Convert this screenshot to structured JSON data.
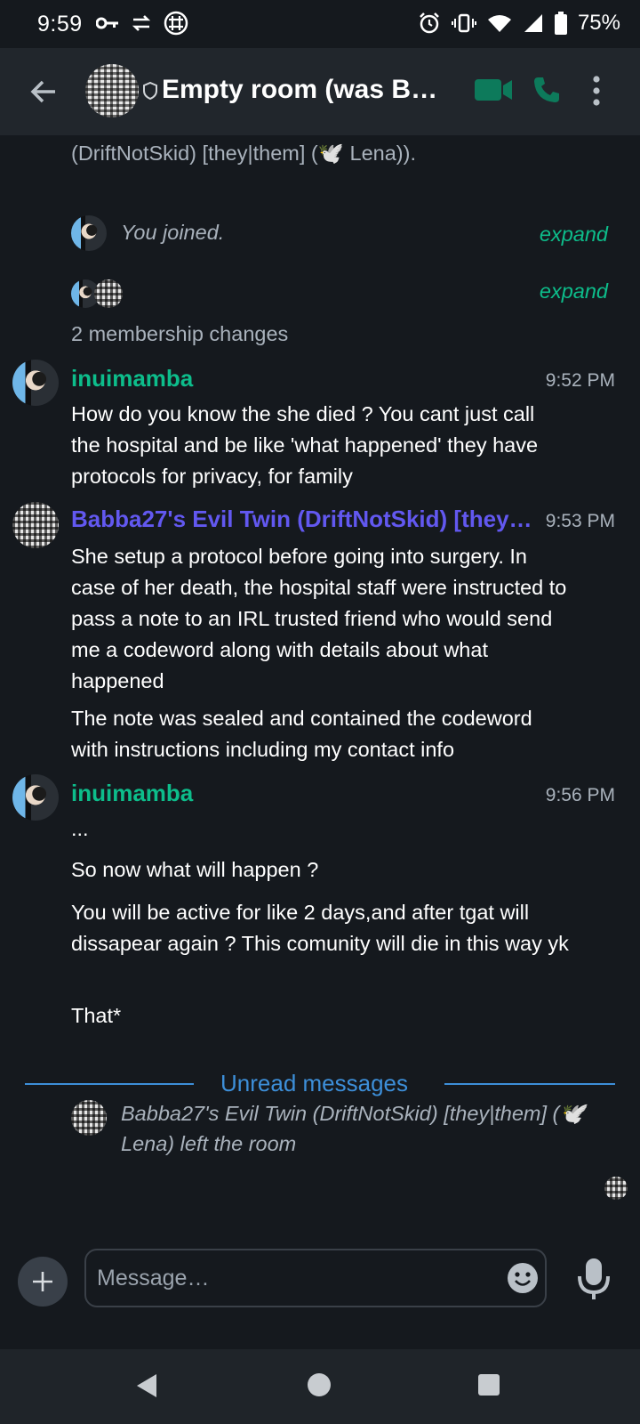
{
  "status_bar": {
    "time": "9:59",
    "battery": "75%",
    "icons": [
      "key-icon",
      "data-swap-icon",
      "grid-app-icon",
      "alarm-icon",
      "vibrate-icon",
      "wifi-icon",
      "signal-icon",
      "battery-icon"
    ]
  },
  "header": {
    "title": "Empty room (was Ba…",
    "icons": [
      "back-arrow-icon",
      "shield-icon",
      "video-call-icon",
      "voice-call-icon",
      "more-vert-icon"
    ]
  },
  "timeline": {
    "partial_text": "(DriftNotSkid) [they|them] (🕊️ Lena)).",
    "joined_text": "You joined.",
    "expand_label_1": "expand",
    "expand_label_2": "expand",
    "membership_changes": "2 membership changes",
    "messages": [
      {
        "sender": "inuimamba",
        "time": "9:52 PM",
        "paragraphs": [
          "How do you know the she died ? You cant just call the hospital and be like 'what happened' they have protocols for privacy, for family"
        ]
      },
      {
        "sender": "Babba27's Evil Twin (DriftNotSkid) [they|…",
        "time": "9:53 PM",
        "paragraphs": [
          "She setup a protocol before going into surgery. In case of her death, the hospital staff were instructed to pass a note to an IRL trusted friend who would send me a codeword along with details about what happened",
          "The note was sealed and contained the codeword with instructions including my contact info"
        ]
      },
      {
        "sender": "inuimamba",
        "time": "9:56 PM",
        "paragraphs": [
          "...",
          "So now what will happen ?",
          "You will be active for like 2 days,and after tgat will dissapear again ? This comunity will die in this way yk",
          "That*"
        ]
      }
    ],
    "unread_label": "Unread messages",
    "left_event": "Babba27's Evil Twin (DriftNotSkid) [they|them] (🕊️ Lena) left the room"
  },
  "composer": {
    "placeholder": "Message…"
  },
  "colors": {
    "background": "#15191e",
    "appbar": "#21262c",
    "accent_green": "#0dbd8b",
    "sender_purple": "#6258f0",
    "unread_blue": "#3d8fd9"
  }
}
